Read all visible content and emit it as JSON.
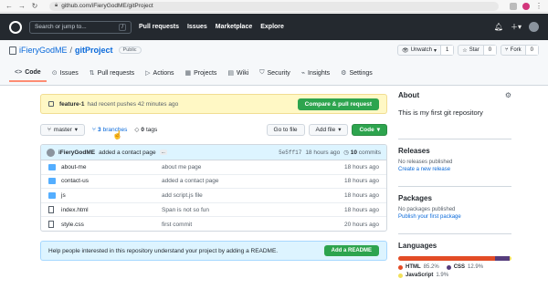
{
  "browser": {
    "url": "github.com/iFieryGodME/gitProject"
  },
  "header": {
    "search_placeholder": "Search or jump to...",
    "search_shortcut": "/",
    "nav": [
      "Pull requests",
      "Issues",
      "Marketplace",
      "Explore"
    ]
  },
  "repo": {
    "owner": "iFieryGodME",
    "separator": "/",
    "name": "gitProject",
    "visibility": "Public",
    "unwatch_label": "Unwatch",
    "unwatch_count": "1",
    "star_label": "Star",
    "star_count": "0",
    "fork_label": "Fork",
    "fork_count": "0"
  },
  "tabs": [
    {
      "label": "Code",
      "icon": "code-icon"
    },
    {
      "label": "Issues",
      "icon": "issue-icon"
    },
    {
      "label": "Pull requests",
      "icon": "pull-request-icon"
    },
    {
      "label": "Actions",
      "icon": "play-icon"
    },
    {
      "label": "Projects",
      "icon": "table-icon"
    },
    {
      "label": "Wiki",
      "icon": "book-icon"
    },
    {
      "label": "Security",
      "icon": "shield-icon"
    },
    {
      "label": "Insights",
      "icon": "graph-icon"
    },
    {
      "label": "Settings",
      "icon": "gear-icon"
    }
  ],
  "push_banner": {
    "branch": "feature-1",
    "text": "had recent pushes 42 minutes ago",
    "button": "Compare & pull request"
  },
  "toolbar": {
    "branch": "master",
    "branches_count": "3",
    "branches_label": "branches",
    "tags_count": "0",
    "tags_label": "tags",
    "goto_file": "Go to file",
    "add_file": "Add file",
    "code": "Code"
  },
  "latest_commit": {
    "author": "iFieryGodME",
    "message": "added a contact page",
    "ellipsis": "...",
    "sha": "5e5ff17",
    "time": "18 hours ago",
    "commits_count": "10",
    "commits_label": "commits"
  },
  "files": [
    {
      "name": "about-me",
      "type": "dir",
      "message": "about me page",
      "date": "18 hours ago"
    },
    {
      "name": "contact-us",
      "type": "dir",
      "message": "added a contact page",
      "date": "18 hours ago"
    },
    {
      "name": "js",
      "type": "dir",
      "message": "add script.js file",
      "date": "18 hours ago"
    },
    {
      "name": "index.html",
      "type": "file",
      "message": "Span is not so fun",
      "date": "18 hours ago"
    },
    {
      "name": "style.css",
      "type": "file",
      "message": "first commit",
      "date": "20 hours ago"
    }
  ],
  "readme_banner": {
    "text": "Help people interested in this repository understand your project by adding a README.",
    "button": "Add a README"
  },
  "sidebar": {
    "about_title": "About",
    "about_desc": "This is my first git repository",
    "releases_title": "Releases",
    "releases_muted": "No releases published",
    "releases_link": "Create a new release",
    "packages_title": "Packages",
    "packages_muted": "No packages published",
    "packages_link": "Publish your first package",
    "languages_title": "Languages",
    "languages": [
      {
        "name": "HTML",
        "pct": "85.2%",
        "value": 85.2,
        "color": "#e34c26"
      },
      {
        "name": "CSS",
        "pct": "12.9%",
        "value": 12.9,
        "color": "#563d7c"
      },
      {
        "name": "JavaScript",
        "pct": "1.9%",
        "value": 1.9,
        "color": "#f1e05a"
      }
    ]
  }
}
